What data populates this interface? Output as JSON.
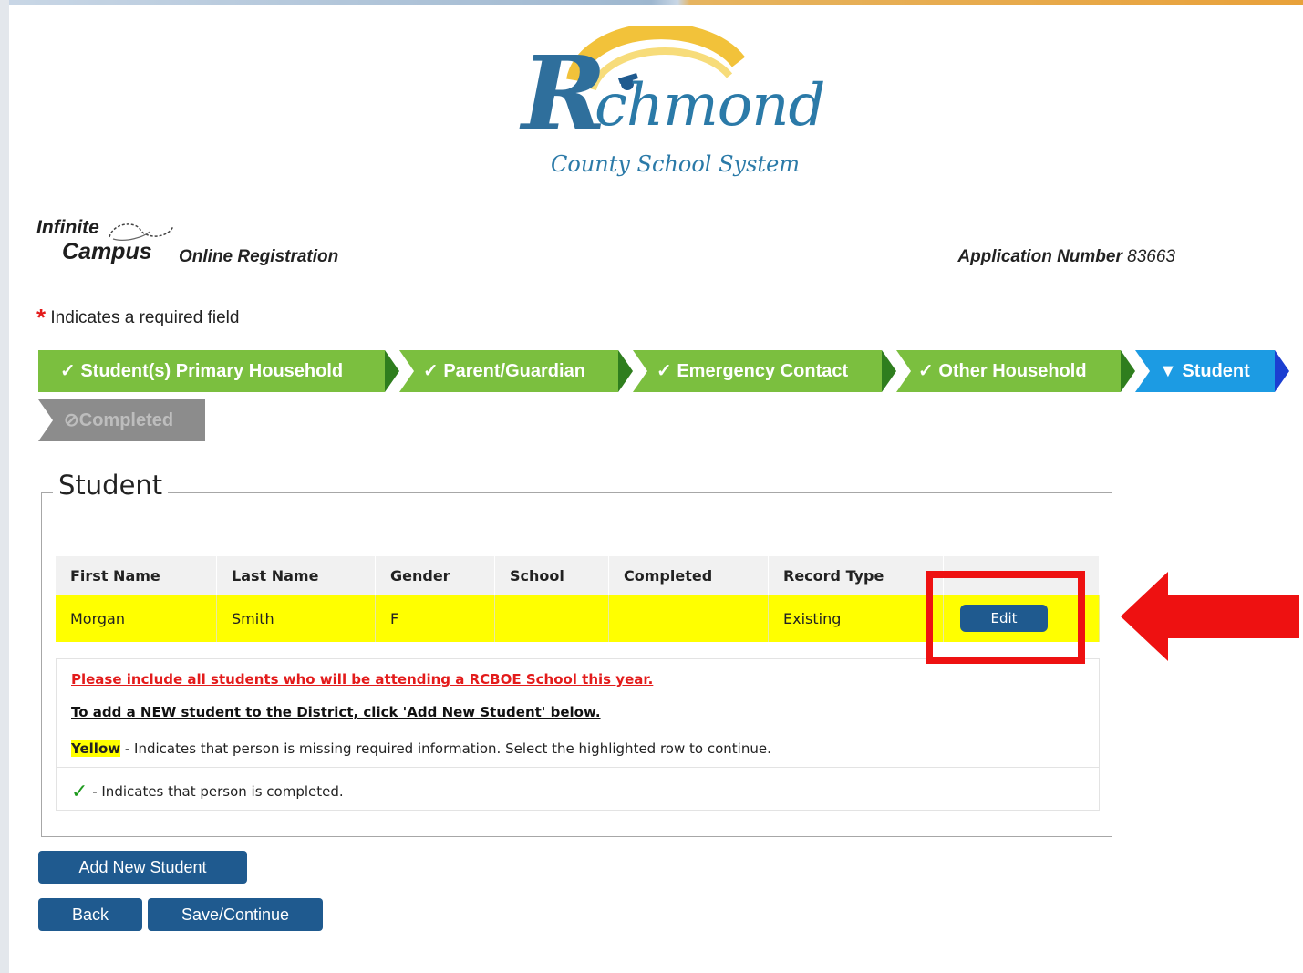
{
  "logo": {
    "initial": "R",
    "word": "chmond",
    "subtitle": "County School System"
  },
  "branding": {
    "infinite": "Infinite",
    "campus": "Campus",
    "product": "Online Registration"
  },
  "application": {
    "label": "Application Number",
    "number": "83663"
  },
  "required_note": {
    "star": "*",
    "text": "Indicates a required field"
  },
  "steps": [
    {
      "label": "✓ Student(s) Primary Household",
      "state": "done"
    },
    {
      "label": "✓ Parent/Guardian",
      "state": "done"
    },
    {
      "label": "✓ Emergency Contact",
      "state": "done"
    },
    {
      "label": "✓ Other Household",
      "state": "done"
    },
    {
      "label": "▼ Student",
      "state": "current"
    },
    {
      "label": "⊘Completed",
      "state": "pending"
    }
  ],
  "student_section": {
    "legend": "Student",
    "columns": [
      "First Name",
      "Last Name",
      "Gender",
      "School",
      "Completed",
      "Record Type"
    ],
    "rows": [
      {
        "first_name": "Morgan",
        "last_name": "Smith",
        "gender": "F",
        "school": "",
        "completed": "",
        "record_type": "Existing",
        "action": "Edit"
      }
    ],
    "notice_red": "Please include all students who will be attending a RCBOE School this year.",
    "notice_add": "To add a NEW student to the District, click 'Add New Student' below.",
    "legend_yellow_word": "Yellow",
    "legend_yellow_text": " - Indicates that person is missing required information. Select the highlighted row to continue.",
    "legend_check_symbol": "✓",
    "legend_check_text": " - Indicates that person is completed."
  },
  "buttons": {
    "add_new": "Add New Student",
    "back": "Back",
    "save_continue": "Save/Continue"
  },
  "annotation": {
    "color": "#ee1111"
  },
  "colors": {
    "step_done": "#7bbf3f",
    "step_current": "#1c9be3",
    "step_pending": "#8c8c8c",
    "button": "#1f5a8f",
    "highlight_row": "#ffff00"
  }
}
